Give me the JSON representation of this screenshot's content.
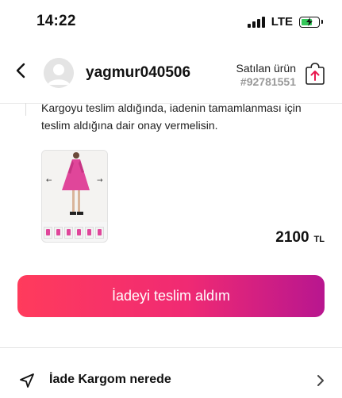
{
  "status_bar": {
    "time": "14:22",
    "network": "LTE",
    "battery_state": "charging",
    "icons": [
      "signal-icon",
      "battery-charging-icon"
    ]
  },
  "header": {
    "username": "yagmur040506",
    "sold_label": "Satılan ürün",
    "sold_id": "#92781551",
    "icons": [
      "back-chevron-icon",
      "avatar-placeholder-icon",
      "share-icon"
    ],
    "accent_color": "#e8194f"
  },
  "info": {
    "message": "Kargoyu teslim aldığında, iadenin tamamlanması için teslim aldığına dair onay vermelisin."
  },
  "product": {
    "thumbnail_count": 6,
    "dress_color": "#e0469a",
    "price_amount": "2100",
    "price_currency": "TL"
  },
  "actions": {
    "confirm_label": "İadeyi teslim aldım",
    "gradient": [
      "#ff3b5c",
      "#f02a73",
      "#b8168f"
    ]
  },
  "list": {
    "items": [
      {
        "label": "İade Kargom nerede",
        "icon": "navigation-arrow-icon"
      }
    ]
  }
}
